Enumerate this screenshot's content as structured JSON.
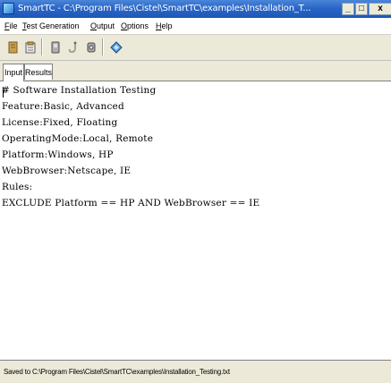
{
  "window": {
    "title": "SmartTC - C:\\Program Files\\Cistel\\SmartTC\\examples\\Installation_T..."
  },
  "menu": {
    "items": [
      {
        "label": "File",
        "underline": "F",
        "rest": "ile"
      },
      {
        "label": "Test Generation",
        "underline": "T",
        "rest": "est Generation"
      },
      {
        "label": "Output",
        "underline": "O",
        "rest": "utput"
      },
      {
        "label": "Options",
        "underline": "O",
        "rest": "ptions"
      },
      {
        "label": "Help",
        "underline": "H",
        "rest": "elp"
      }
    ]
  },
  "toolbar": {
    "icons": [
      "pencil-icon",
      "clipboard-icon",
      "book-icon",
      "guitar-icon",
      "gear-icon",
      "diamond-icon"
    ]
  },
  "tabs": [
    {
      "label": "Input",
      "active": true
    },
    {
      "label": "Results",
      "active": false
    }
  ],
  "editor": {
    "lines": [
      "# Software Installation Testing",
      "Feature:Basic, Advanced",
      "License:Fixed, Floating",
      "OperatingMode:Local, Remote",
      "Platform:Windows, HP",
      "WebBrowser:Netscape, IE",
      "Rules:",
      "EXCLUDE Platform == HP AND WebBrowser == IE"
    ]
  },
  "status": {
    "text": "Saved to C:\\Program Files\\Cistel\\SmartTC\\examples\\Installation_Testing.txt"
  },
  "colors": {
    "titlebar": "#2a66c8",
    "menubar": "#ffffff",
    "chrome": "#ece9d8"
  }
}
